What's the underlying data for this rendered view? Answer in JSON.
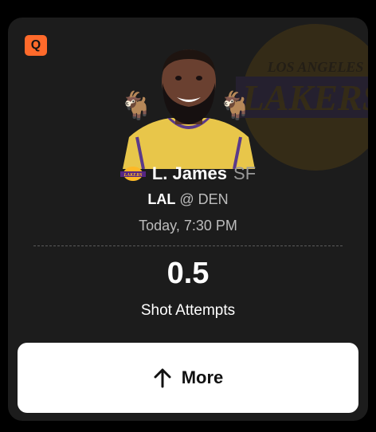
{
  "badge": {
    "letter": "Q",
    "color": "#ff6a2b"
  },
  "watermark": {
    "icon": "lakers-logo-icon",
    "text_top": "LOS ANGELES",
    "text_main": "LAKERS"
  },
  "player": {
    "name": "L. James",
    "position": "SF",
    "team_logo_icon": "lakers-logo-icon",
    "goat_emoji": "🐐"
  },
  "matchup": {
    "home": "LAL",
    "separator": "@",
    "away": "DEN"
  },
  "game_time": "Today, 7:30 PM",
  "line": {
    "value": "0.5",
    "stat": "Shot Attempts"
  },
  "more_button": {
    "label": "More",
    "icon": "arrow-up-icon"
  },
  "colors": {
    "card_bg": "#1c1c1c",
    "page_bg": "#000000",
    "lakers_purple": "#552583",
    "lakers_gold": "#fdb927"
  }
}
